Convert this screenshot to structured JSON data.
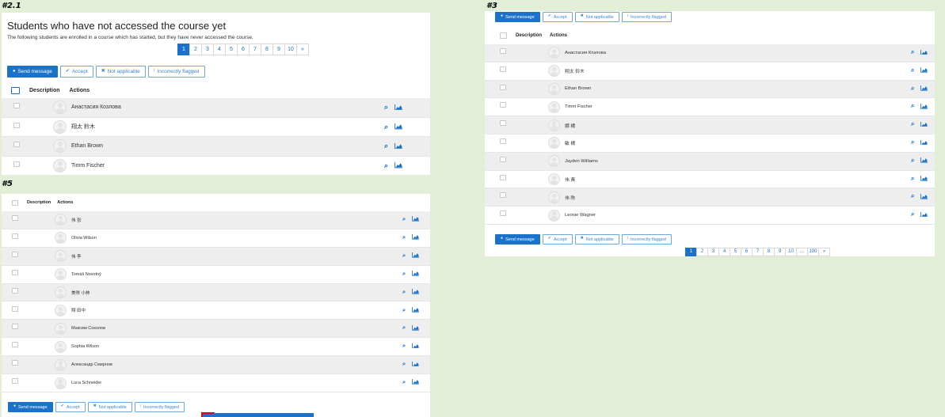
{
  "panels": {
    "p21": {
      "label": "#2.1",
      "title": "Students who have not accessed the course yet",
      "description": "The following students are enrolled in a course which has started, but they have never accessed the course.",
      "pager": [
        "1",
        "2",
        "3",
        "4",
        "5",
        "6",
        "7",
        "8",
        "9",
        "10",
        "»"
      ],
      "active_page": "1",
      "buttons": {
        "send": "Send message",
        "accept": "Accept",
        "na": "Not applicable",
        "flag": "Incorrectly flagged"
      },
      "headers": {
        "description": "Description",
        "actions": "Actions"
      },
      "rows": [
        "Анастасия Козлова",
        "翔太 鈴木",
        "Ethan Brown",
        "Timm Fischer"
      ]
    },
    "p3": {
      "label": "#3",
      "buttons": {
        "send": "Send message",
        "accept": "Accept",
        "na": "Not applicable",
        "flag": "Incorrectly flagged"
      },
      "headers": {
        "description": "Description",
        "actions": "Actions"
      },
      "rows": [
        "Анастасия Козлова",
        "翔太 鈴木",
        "Ethan Brown",
        "Timm Fischer",
        "娜 楊",
        "敏 楊",
        "Jayden Williams",
        "伟 黃",
        "伟 陈",
        "Leonie Wagner"
      ],
      "pager": [
        "1",
        "2",
        "3",
        "4",
        "5",
        "6",
        "7",
        "8",
        "9",
        "10",
        "…",
        "100",
        "»"
      ],
      "active_page": "1"
    },
    "p5": {
      "label": "#5",
      "headers": {
        "description": "Description",
        "actions": "Actions"
      },
      "rows": [
        "伟 张",
        "Olivia Wilson",
        "伟 李",
        "Tomáš Novotný",
        "美咲 小林",
        "翔 田中",
        "Максим Соколов",
        "Sophia Wilson",
        "Александр Смирнов",
        "Luca Schneider"
      ],
      "buttons": {
        "send": "Send message",
        "accept": "Accept",
        "na": "Not applicable",
        "flag": "Incorrectly flagged"
      }
    }
  },
  "icons": {
    "send": "comment-icon",
    "accept": "check-icon",
    "na": "times-icon",
    "flag": "exclamation-icon",
    "view": "magnifier-icon",
    "report": "area-chart-icon"
  },
  "colors": {
    "accent": "#1a73c8",
    "highlight": "#d60a0a",
    "background": "#e3eed6"
  }
}
